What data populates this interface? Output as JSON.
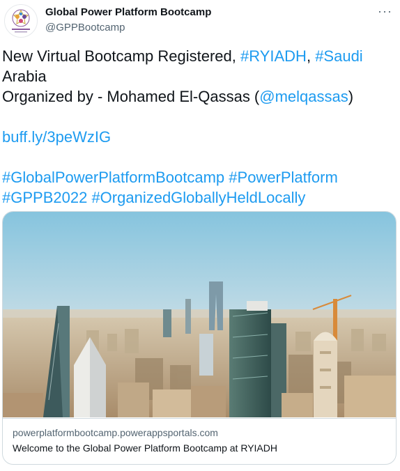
{
  "account": {
    "display_name": "Global Power Platform Bootcamp",
    "handle": "@GPPBootcamp"
  },
  "menu": {
    "more_glyph": "···"
  },
  "tweet": {
    "line1_text": "New Virtual Bootcamp Registered, ",
    "hashtag_ryiadh": "#RYIADH",
    "comma": ", ",
    "hashtag_saudi": "#Saudi",
    "line2_text": "Arabia",
    "line3_text": "Organized by - Mohamed El-Qassas (",
    "mention": "@melqassas",
    "close_paren": ")",
    "short_link": "buff.ly/3peWzIG",
    "hashtag_gppb": "#GlobalPowerPlatformBootcamp",
    "hashtag_pp": "#PowerPlatform",
    "hashtag_2022": "#GPPB2022",
    "hashtag_ogh": "#OrganizedGloballyHeldLocally"
  },
  "link_card": {
    "domain": "powerplatformbootcamp.powerappsportals.com",
    "title": "Welcome to the Global Power Platform Bootcamp at RYIADH"
  },
  "colors": {
    "link": "#1d9bf0",
    "text": "#0f1419",
    "secondary": "#536471",
    "border": "#cfd9de"
  }
}
